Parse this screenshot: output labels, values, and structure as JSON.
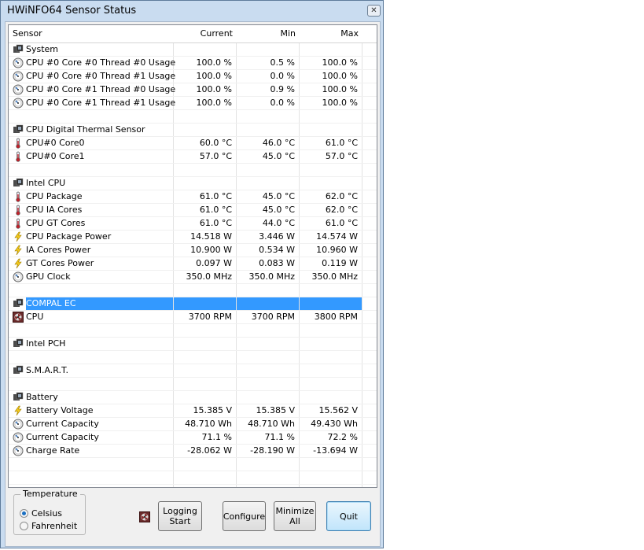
{
  "window": {
    "title": "HWiNFO64 Sensor Status",
    "close_label": "✕"
  },
  "columns": {
    "sensor": "Sensor",
    "current": "Current",
    "min": "Min",
    "max": "Max"
  },
  "rows": [
    {
      "type": "group",
      "icon": "chip",
      "name": "System",
      "current": "",
      "min": "",
      "max": ""
    },
    {
      "type": "data",
      "icon": "gauge",
      "name": "CPU #0 Core #0 Thread #0 Usage",
      "current": "100.0 %",
      "min": "0.5 %",
      "max": "100.0 %"
    },
    {
      "type": "data",
      "icon": "gauge",
      "name": "CPU #0 Core #0 Thread #1 Usage",
      "current": "100.0 %",
      "min": "0.0 %",
      "max": "100.0 %"
    },
    {
      "type": "data",
      "icon": "gauge",
      "name": "CPU #0 Core #1 Thread #0 Usage",
      "current": "100.0 %",
      "min": "0.9 %",
      "max": "100.0 %"
    },
    {
      "type": "data",
      "icon": "gauge",
      "name": "CPU #0 Core #1 Thread #1 Usage",
      "current": "100.0 %",
      "min": "0.0 %",
      "max": "100.0 %"
    },
    {
      "type": "blank"
    },
    {
      "type": "group",
      "icon": "chip",
      "name": "CPU Digital Thermal Sensor",
      "current": "",
      "min": "",
      "max": ""
    },
    {
      "type": "data",
      "icon": "thermometer",
      "name": "CPU#0 Core0",
      "current": "60.0 °C",
      "min": "46.0 °C",
      "max": "61.0 °C"
    },
    {
      "type": "data",
      "icon": "thermometer",
      "name": "CPU#0 Core1",
      "current": "57.0 °C",
      "min": "45.0 °C",
      "max": "57.0 °C"
    },
    {
      "type": "blank"
    },
    {
      "type": "group",
      "icon": "chip",
      "name": "Intel CPU",
      "current": "",
      "min": "",
      "max": ""
    },
    {
      "type": "data",
      "icon": "thermometer",
      "name": "CPU Package",
      "current": "61.0 °C",
      "min": "45.0 °C",
      "max": "62.0 °C"
    },
    {
      "type": "data",
      "icon": "thermometer",
      "name": "CPU IA Cores",
      "current": "61.0 °C",
      "min": "45.0 °C",
      "max": "62.0 °C"
    },
    {
      "type": "data",
      "icon": "thermometer",
      "name": "CPU GT Cores",
      "current": "61.0 °C",
      "min": "44.0 °C",
      "max": "61.0 °C"
    },
    {
      "type": "data",
      "icon": "bolt",
      "name": "CPU Package Power",
      "current": "14.518 W",
      "min": "3.446 W",
      "max": "14.574 W"
    },
    {
      "type": "data",
      "icon": "bolt",
      "name": "IA Cores Power",
      "current": "10.900 W",
      "min": "0.534 W",
      "max": "10.960 W"
    },
    {
      "type": "data",
      "icon": "bolt",
      "name": "GT Cores Power",
      "current": "0.097 W",
      "min": "0.083 W",
      "max": "0.119 W"
    },
    {
      "type": "data",
      "icon": "gauge",
      "name": "GPU Clock",
      "current": "350.0 MHz",
      "min": "350.0 MHz",
      "max": "350.0 MHz"
    },
    {
      "type": "blank"
    },
    {
      "type": "group",
      "icon": "chip",
      "name": "COMPAL EC",
      "current": "",
      "min": "",
      "max": "",
      "selected": true
    },
    {
      "type": "data",
      "icon": "fan",
      "name": "CPU",
      "current": "3700 RPM",
      "min": "3700 RPM",
      "max": "3800 RPM"
    },
    {
      "type": "blank"
    },
    {
      "type": "group",
      "icon": "chip",
      "name": "Intel PCH",
      "current": "",
      "min": "",
      "max": ""
    },
    {
      "type": "blank"
    },
    {
      "type": "group",
      "icon": "chip",
      "name": "S.M.A.R.T.",
      "current": "",
      "min": "",
      "max": ""
    },
    {
      "type": "blank"
    },
    {
      "type": "group",
      "icon": "chip",
      "name": "Battery",
      "current": "",
      "min": "",
      "max": ""
    },
    {
      "type": "data",
      "icon": "bolt",
      "name": "Battery Voltage",
      "current": "15.385 V",
      "min": "15.385 V",
      "max": "15.562 V"
    },
    {
      "type": "data",
      "icon": "gauge",
      "name": "Current Capacity",
      "current": "48.710 Wh",
      "min": "48.710 Wh",
      "max": "49.430 Wh"
    },
    {
      "type": "data",
      "icon": "gauge",
      "name": "Current Capacity",
      "current": "71.1 %",
      "min": "71.1 %",
      "max": "72.2 %"
    },
    {
      "type": "data",
      "icon": "gauge",
      "name": "Charge Rate",
      "current": "-28.062 W",
      "min": "-28.190 W",
      "max": "-13.694 W"
    },
    {
      "type": "blank"
    },
    {
      "type": "blank"
    }
  ],
  "temperature": {
    "label": "Temperature",
    "options": [
      {
        "label": "Celsius",
        "selected": true
      },
      {
        "label": "Fahrenheit",
        "selected": false
      }
    ]
  },
  "buttons": {
    "logging": [
      "Logging",
      "Start"
    ],
    "configure": "Configure",
    "minimize": [
      "Minimize",
      "All"
    ],
    "quit": "Quit"
  },
  "colors": {
    "selection": "#3399ff",
    "title_bar": "#c9dcf0"
  }
}
